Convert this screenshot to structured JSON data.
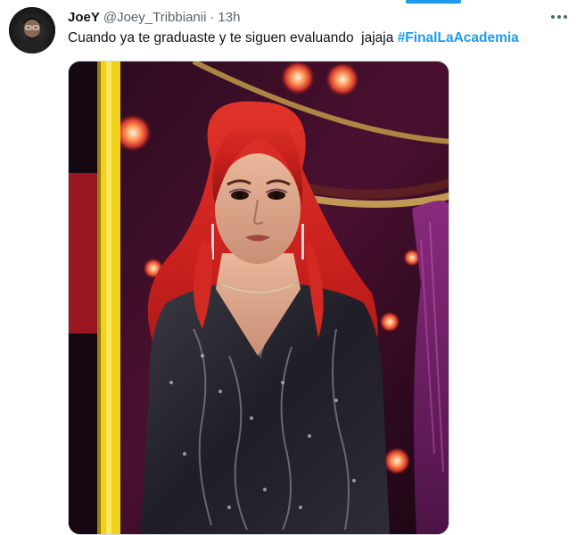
{
  "tweet": {
    "display_name": "JoeY",
    "handle": "@Joey_Tribbianii",
    "separator": "·",
    "time": "13h",
    "text": "Cuando ya te graduaste y te siguen evaluando  jajaja ",
    "hashtag": "#FinalLaAcademia",
    "more_icon": "more-horizontal-icon",
    "avatar_icon": "user-avatar"
  },
  "colors": {
    "accent": "#1d9bf0",
    "text": "#0f1419",
    "secondary": "#536471"
  }
}
